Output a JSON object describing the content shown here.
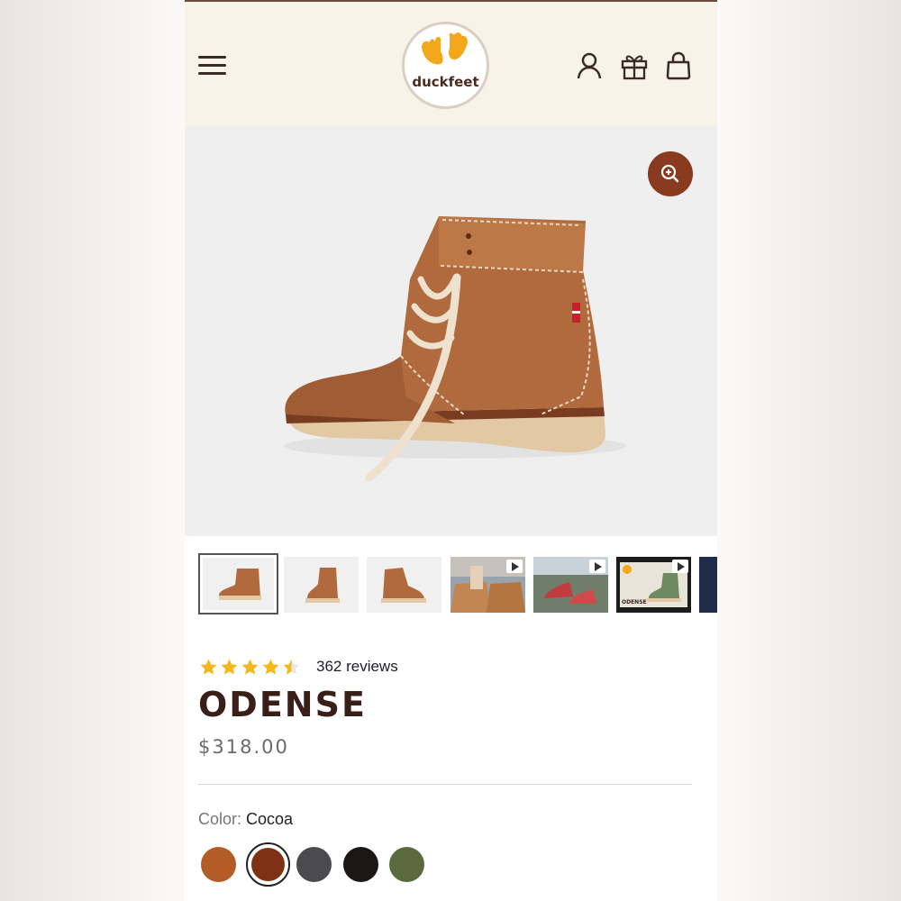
{
  "header": {
    "logo_text": "duckfeet",
    "icons": [
      "menu-icon",
      "account-icon",
      "gift-icon",
      "bag-icon"
    ]
  },
  "gallery": {
    "zoom_icon": "zoom-in-icon",
    "thumbnails": [
      {
        "name": "boot-side-view",
        "video": false
      },
      {
        "name": "boot-front-view",
        "video": false
      },
      {
        "name": "boot-back-view",
        "video": false
      },
      {
        "name": "lacing-video",
        "video": true
      },
      {
        "name": "outdoor-red-boots",
        "video": true
      },
      {
        "name": "odense-video",
        "video": true,
        "overlay_text": "ODENSE"
      },
      {
        "name": "more-thumbnail",
        "video": false
      }
    ]
  },
  "product": {
    "rating": 4.5,
    "review_count_text": "362 reviews",
    "title": "ODENSE",
    "price": "$318.00",
    "color_label": "Color:",
    "color_value": "Cocoa",
    "swatches": [
      {
        "name": "swatch-tan",
        "color": "#b35c27",
        "selected": false
      },
      {
        "name": "swatch-cocoa",
        "color": "#7f3115",
        "selected": true
      },
      {
        "name": "swatch-grey",
        "color": "#4a4a4f",
        "selected": false
      },
      {
        "name": "swatch-black",
        "color": "#1d1616",
        "selected": false
      },
      {
        "name": "swatch-green",
        "color": "#5a6a3e",
        "selected": false
      }
    ]
  },
  "colors": {
    "header_bg": "#f8f3e8",
    "accent": "#8a3a1e",
    "star": "#f2b81c",
    "title": "#3a1f18"
  }
}
